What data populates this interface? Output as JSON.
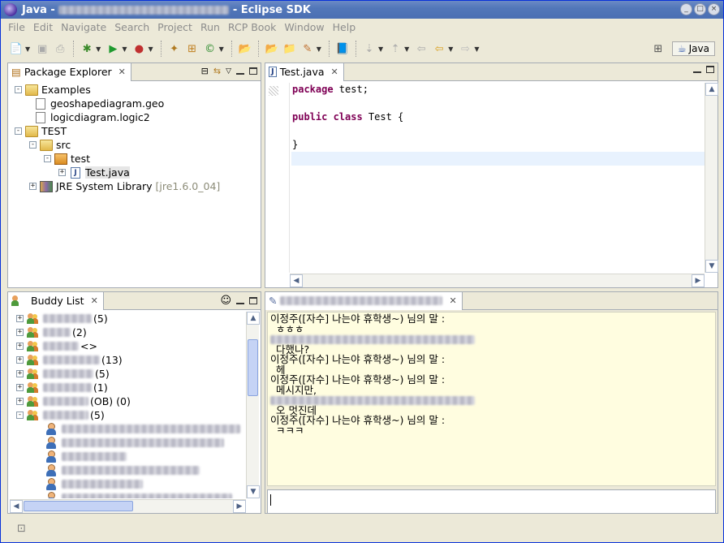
{
  "window": {
    "title_prefix": "Java - ",
    "title_suffix": " - Eclipse SDK",
    "controls": [
      "_",
      "□",
      "×"
    ]
  },
  "menu": [
    "File",
    "Edit",
    "Navigate",
    "Search",
    "Project",
    "Run",
    "RCP Book",
    "Window",
    "Help"
  ],
  "perspective": {
    "label": "Java"
  },
  "package_explorer": {
    "tab_label": "Package Explorer",
    "items": [
      {
        "label": "Examples"
      },
      {
        "label": "geoshapediagram.geo"
      },
      {
        "label": "logicdiagram.logic2"
      },
      {
        "label": "TEST"
      },
      {
        "label": "src"
      },
      {
        "label": "test"
      },
      {
        "label": "Test.java"
      },
      {
        "label": "JRE System Library",
        "suffix": "[jre1.6.0_04]"
      }
    ]
  },
  "editor": {
    "tab_label": "Test.java",
    "lines": [
      {
        "kw": "package",
        "rest": " test;"
      },
      {
        "kw": "",
        "rest": ""
      },
      {
        "kw": "public class",
        "rest": " Test {"
      },
      {
        "kw": "",
        "rest": ""
      },
      {
        "kw": "",
        "rest": "}"
      },
      {
        "kw": "",
        "rest": ""
      }
    ]
  },
  "buddy_list": {
    "tab_label": "Buddy List",
    "groups": [
      {
        "count": "(5)"
      },
      {
        "count": "(2)"
      },
      {
        "count": "<>"
      },
      {
        "count": "(13)"
      },
      {
        "count": "(5)"
      },
      {
        "count": "(1)"
      },
      {
        "count": "(OB) (0)"
      },
      {
        "count": "(5)"
      }
    ]
  },
  "chat": {
    "messages": [
      {
        "type": "header",
        "text": "이정주([자수] 나는야 휴학생~) 님의 말 :"
      },
      {
        "type": "msg",
        "text": "ㅎㅎㅎ"
      },
      {
        "type": "header_blur",
        "text": ""
      },
      {
        "type": "msg",
        "text": "다했나?"
      },
      {
        "type": "header",
        "text": "이정주([자수] 나는야 휴학생~) 님의 말 :"
      },
      {
        "type": "msg",
        "text": "헤"
      },
      {
        "type": "header",
        "text": "이정주([자수] 나는야 휴학생~) 님의 말 :"
      },
      {
        "type": "msg",
        "text": "메시지만,"
      },
      {
        "type": "header_blur",
        "text": ""
      },
      {
        "type": "msg",
        "text": "오 멋진데"
      },
      {
        "type": "header",
        "text": "이정주([자수] 나는야 휴학생~) 님의 말 :"
      },
      {
        "type": "msg",
        "text": "ㅋㅋㅋ"
      }
    ]
  }
}
